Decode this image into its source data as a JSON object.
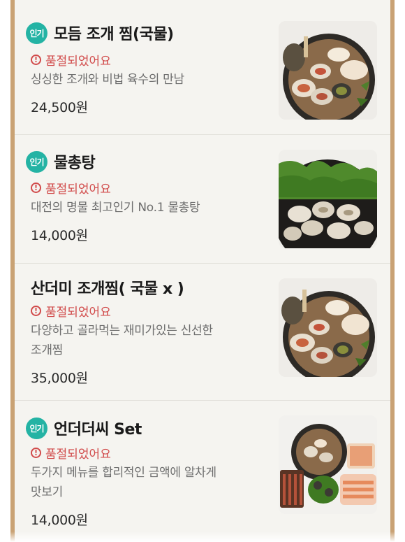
{
  "menu": {
    "items": [
      {
        "badge": "인기",
        "name": "모듬 조개 찜(국물)",
        "status": "품절되었어요",
        "description": "싱싱한 조개와 비법 육수의 만남",
        "price": "24,500원",
        "image": "steamed-clams-with-broth"
      },
      {
        "badge": "인기",
        "name": "물총탕",
        "status": "품절되었어요",
        "description": "대전의 명물 최고인기 No.1 물총탕",
        "price": "14,000원",
        "image": "clam-soup-with-greens"
      },
      {
        "badge": "",
        "name": "산더미 조개찜( 국물 x )",
        "status": "품절되었어요",
        "description_line1": "다양하고 골라먹는 재미가있는 신선한",
        "description_line2": "조개찜",
        "price": "35,000원",
        "image": "steamed-clams-mountain"
      },
      {
        "badge": "인기",
        "name": "언더더씨 Set",
        "status": "품절되었어요",
        "description_line1": "두가지 메뉴를 합리적인 금액에 알차게",
        "description_line2": "맛보기",
        "price": "14,000원",
        "image": "seafood-set-platter"
      }
    ]
  },
  "colors": {
    "badge": "#24b3a4",
    "soldout": "#d14a4a",
    "rail": "#c9a274",
    "card_bg": "#f5f4f0"
  }
}
